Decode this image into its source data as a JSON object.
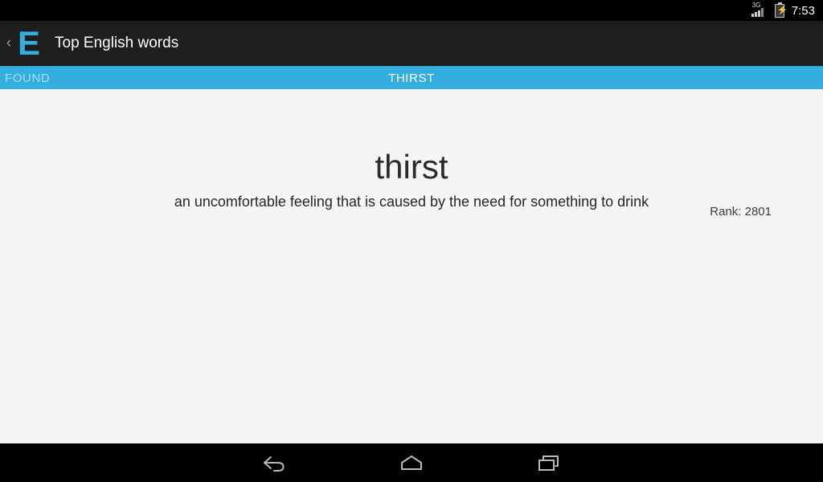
{
  "status_bar": {
    "network_label": "3G",
    "signal_icon": "signal-bars-icon",
    "battery_icon": "battery-charging-icon",
    "time": "7:53"
  },
  "action_bar": {
    "up_chevron": "‹",
    "logo_letter": "E",
    "title": "Top English words",
    "logo_color": "#33aede",
    "background_color": "#1e1e1e"
  },
  "tabs": {
    "accent_color": "#33aede",
    "inactive": {
      "label": "FOUND",
      "color": "#aadcf2"
    },
    "active": {
      "label": "THIRST",
      "color": "#ffffff"
    }
  },
  "content": {
    "rank_label": "Rank: 2801",
    "word": "thirst",
    "definition": "an uncomfortable feeling that is caused by the need for something to drink",
    "background_color": "#f5f5f5"
  },
  "nav_bar": {
    "back": "back-icon",
    "home": "home-icon",
    "recents": "recents-icon"
  }
}
